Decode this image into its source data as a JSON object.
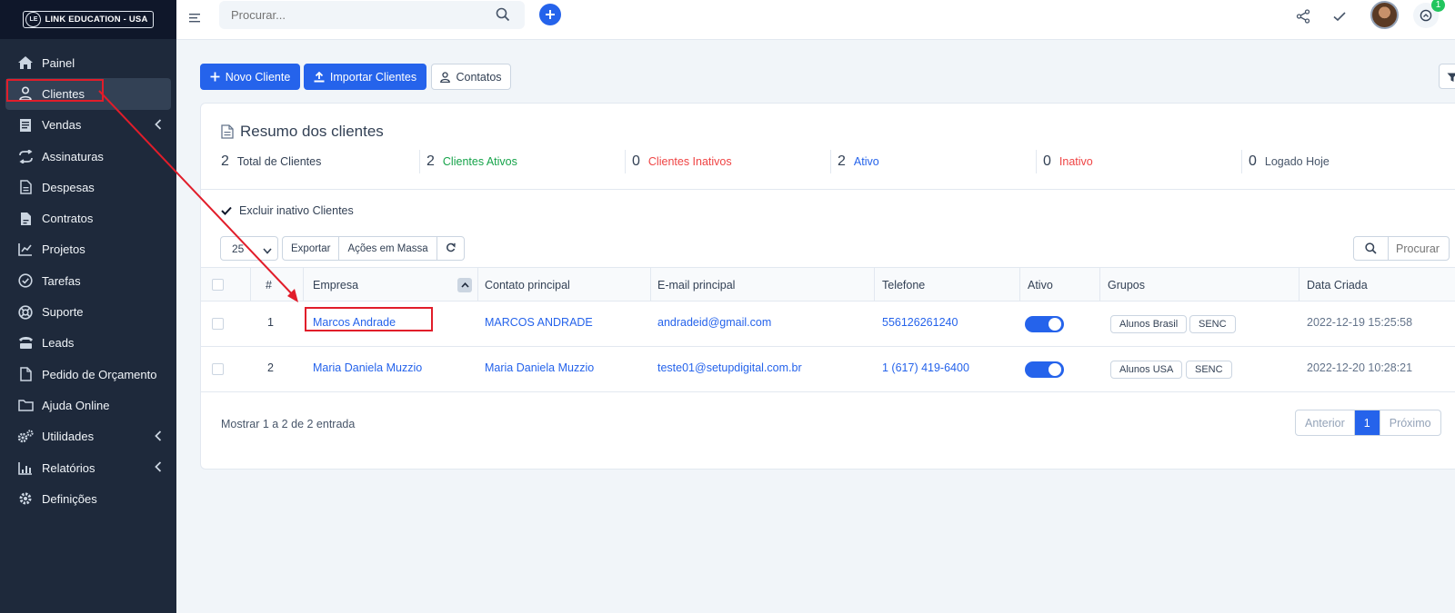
{
  "brand": {
    "logo_text": "LINK EDUCATION - USA",
    "logo_mark": "LE"
  },
  "sidebar": {
    "items": [
      {
        "label": "Painel",
        "icon": "home-icon"
      },
      {
        "label": "Clientes",
        "icon": "user-icon"
      },
      {
        "label": "Vendas",
        "icon": "receipt-icon"
      },
      {
        "label": "Assinaturas",
        "icon": "repeat-icon"
      },
      {
        "label": "Despesas",
        "icon": "document-icon"
      },
      {
        "label": "Contratos",
        "icon": "contract-icon"
      },
      {
        "label": "Projetos",
        "icon": "chart-icon"
      },
      {
        "label": "Tarefas",
        "icon": "check-circle-icon"
      },
      {
        "label": "Suporte",
        "icon": "lifebuoy-icon"
      },
      {
        "label": "Leads",
        "icon": "tty-icon"
      },
      {
        "label": "Pedido de Orçamento",
        "icon": "file-icon"
      },
      {
        "label": "Ajuda Online",
        "icon": "folder-icon"
      },
      {
        "label": "Utilidades",
        "icon": "cogs-icon"
      },
      {
        "label": "Relatórios",
        "icon": "bar-chart-icon"
      },
      {
        "label": "Definições",
        "icon": "gear-icon"
      }
    ]
  },
  "topbar": {
    "search_placeholder": "Procurar...",
    "notification_count": "1"
  },
  "actions": {
    "new_client": "Novo Cliente",
    "import_clients": "Importar Clientes",
    "contacts": "Contatos"
  },
  "summary": {
    "title": "Resumo dos clientes",
    "stats": [
      {
        "value": "2",
        "label": "Total de Clientes",
        "color": "#334155"
      },
      {
        "value": "2",
        "label": "Clientes Ativos",
        "color": "#16a34a"
      },
      {
        "value": "0",
        "label": "Clientes Inativos",
        "color": "#ef4444"
      },
      {
        "value": "2",
        "label": "Ativo",
        "color": "#2563eb"
      },
      {
        "value": "0",
        "label": "Inativo",
        "color": "#ef4444"
      },
      {
        "value": "0",
        "label": "Logado Hoje",
        "color": "#475569"
      }
    ]
  },
  "filters": {
    "exclude_inactive": "Excluir inativo Clientes",
    "page_size": "25",
    "export": "Exportar",
    "bulk_actions": "Ações em Massa",
    "search_placeholder": "Procurar"
  },
  "table": {
    "headers": {
      "num": "#",
      "company": "Empresa",
      "contact": "Contato principal",
      "email": "E-mail principal",
      "phone": "Telefone",
      "active": "Ativo",
      "groups": "Grupos",
      "created": "Data Criada"
    },
    "rows": [
      {
        "num": "1",
        "company": "Marcos Andrade",
        "contact": "MARCOS ANDRADE",
        "email": "andradeid@gmail.com",
        "phone": "556126261240",
        "active": true,
        "groups": [
          "Alunos Brasil",
          "SENC"
        ],
        "created": "2022-12-19 15:25:58"
      },
      {
        "num": "2",
        "company": "Maria Daniela Muzzio",
        "contact": "Maria Daniela Muzzio",
        "email": "teste01@setupdigital.com.br",
        "phone": "1 (617) 419-6400",
        "active": true,
        "groups": [
          "Alunos USA",
          "SENC"
        ],
        "created": "2022-12-20 10:28:21"
      }
    ]
  },
  "footer": {
    "showing": "Mostrar 1 a 2 de 2 entrada",
    "prev": "Anterior",
    "page": "1",
    "next": "Próximo"
  },
  "colors": {
    "sidebar_bg": "#1e293b",
    "accent": "#2563eb",
    "annotation": "#e11d2a"
  }
}
